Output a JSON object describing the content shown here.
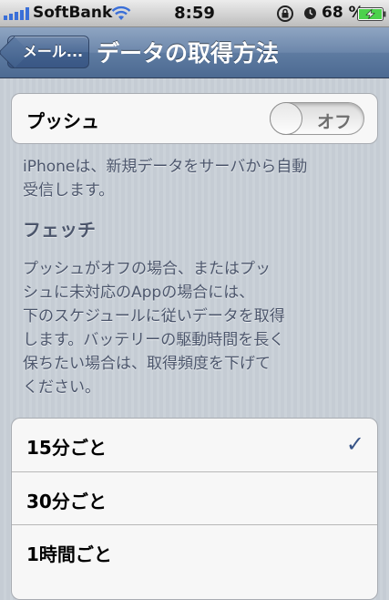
{
  "status_bar": {
    "carrier": "SoftBank",
    "time": "8:59",
    "battery_percent": "68 %"
  },
  "nav": {
    "back_label": "メール...",
    "title": "データの取得方法"
  },
  "push": {
    "label": "プッシュ",
    "toggle_state": "オフ",
    "description": "iPhoneは、新規データをサーバから自動\n受信します。"
  },
  "fetch": {
    "heading": "フェッチ",
    "description": "プッシュがオフの場合、またはプッ\nシュに未対応のAppの場合には、\n下のスケジュールに従いデータを取得\nします。バッテリーの駆動時間を長く\n保ちたい場合は、取得頻度を下げて\nください。"
  },
  "schedule": {
    "options": [
      {
        "label": "15分ごと",
        "selected": true
      },
      {
        "label": "30分ごと",
        "selected": false
      },
      {
        "label": "1時間ごと",
        "selected": false
      }
    ],
    "checkmark": "✓"
  },
  "colors": {
    "nav_bar": "#5e7ba1",
    "checkmark": "#385487",
    "section_text": "#4c566c",
    "battery_fill": "#4cd14c"
  }
}
